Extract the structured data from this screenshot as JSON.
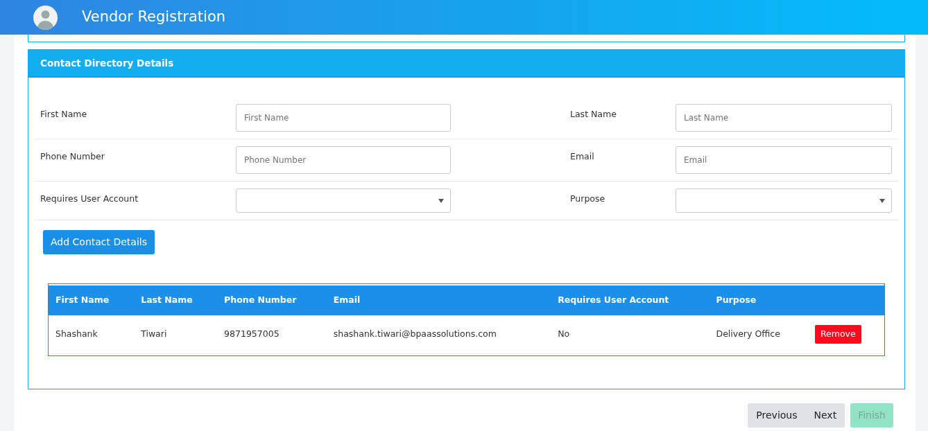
{
  "header": {
    "title": "Vendor Registration"
  },
  "card": {
    "title": "Contact Directory Details",
    "field_rows": [
      [
        {
          "label": "First Name",
          "kind": "text",
          "placeholder": "First Name"
        },
        {
          "label": "Last Name",
          "kind": "text",
          "placeholder": "Last Name"
        }
      ],
      [
        {
          "label": "Phone Number",
          "kind": "text",
          "placeholder": "Phone Number"
        },
        {
          "label": "Email",
          "kind": "text",
          "placeholder": "Email"
        }
      ],
      [
        {
          "label": "Requires User Account",
          "kind": "select"
        },
        {
          "label": "Purpose",
          "kind": "select"
        }
      ]
    ],
    "add_button": "Add Contact Details",
    "table": {
      "columns": [
        "First Name",
        "Last Name",
        "Phone Number",
        "Email",
        "Requires User Account",
        "Purpose"
      ],
      "rows": [
        {
          "cells": [
            "Shashank",
            "Tiwari",
            "9871957005",
            "shashank.tiwari@bpaassolutions.com",
            "No",
            "Delivery Office"
          ],
          "action": "Remove"
        }
      ]
    }
  },
  "nav_buttons": [
    {
      "label": "Previous",
      "kind": "group",
      "disabled": false
    },
    {
      "label": "Next",
      "kind": "group",
      "disabled": false
    },
    {
      "label": "Finish",
      "kind": "finish",
      "disabled": true
    }
  ]
}
